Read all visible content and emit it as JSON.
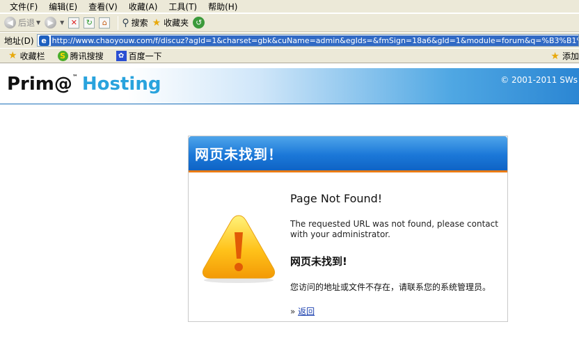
{
  "menu": [
    "文件(F)",
    "编辑(E)",
    "查看(V)",
    "收藏(A)",
    "工具(T)",
    "帮助(H)"
  ],
  "toolbar": {
    "back_label": "后退",
    "search_label": "搜索",
    "favorites_label": "收藏夹"
  },
  "address": {
    "label": "地址(D)",
    "url": "http://www.chaoyouw.com/f/discuz?agId=1&charset=gbk&cuName=admin&egIds=&fmSign=18a6&gId=1&module=forum&q=%B3%B1%C8%CB%CD%BC%"
  },
  "favbar": {
    "favorites_label": "收藏栏",
    "items": [
      "腾讯搜搜",
      "百度一下"
    ],
    "add_label": "添加"
  },
  "banner": {
    "logo_prima": "Prim@",
    "logo_tm": "™",
    "logo_hosting": "Hosting",
    "copyright": "© 2001-2011 SWs"
  },
  "panel": {
    "title_cn": "网页未找到！",
    "heading_en": "Page Not Found!",
    "message_en": "The requested URL was not found, please contact with your administrator.",
    "heading_cn": "网页未找到!",
    "message_cn": "您访问的地址或文件不存在，请联系您的系统管理员。",
    "back_prefix": "»",
    "back_link": "返回"
  },
  "colors": {
    "chrome": "#ece9d8",
    "header_blue": "#1b78d8",
    "accent_orange": "#ea7b12",
    "logo_blue": "#29a3dd"
  }
}
